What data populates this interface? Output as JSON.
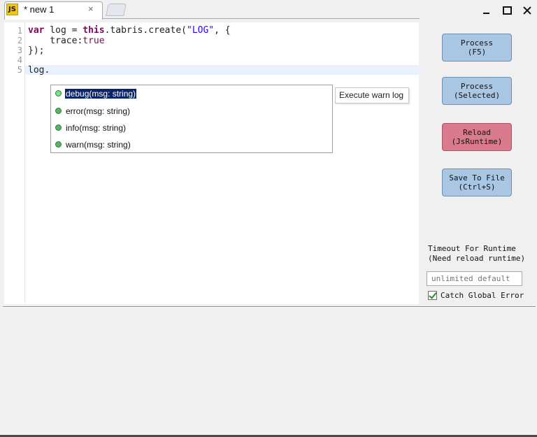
{
  "tab": {
    "icon_text": "JS",
    "title": "* new 1",
    "close": "×"
  },
  "window": {
    "minimize": "minimize",
    "maximize": "maximize",
    "close": "close"
  },
  "editor": {
    "line_numbers": [
      "1",
      "2",
      "3",
      "4",
      "5"
    ],
    "lines": {
      "l1_kw1": "var",
      "l1_mid": " log = ",
      "l1_kw2": "this",
      "l1_call": ".tabris.create(",
      "l1_str": "\"LOG\"",
      "l1_end": ", {",
      "l2_key": "    trace:",
      "l2_val": "true",
      "l3": "});",
      "l5": "log."
    }
  },
  "autocomplete": {
    "items": [
      {
        "label": "debug(msg: string)",
        "selected": true
      },
      {
        "label": "error(msg: string)",
        "selected": false
      },
      {
        "label": "info(msg: string)",
        "selected": false
      },
      {
        "label": "warn(msg: string)",
        "selected": false
      }
    ],
    "tooltip": "Execute warn log"
  },
  "panel": {
    "process": {
      "line1": "Process",
      "line2": "(F5)"
    },
    "process_selected": {
      "line1": "Process",
      "line2": "(Selected)"
    },
    "reload": {
      "line1": "Reload",
      "line2": "(JsRuntime)"
    },
    "save": {
      "line1": "Save To File",
      "line2": "(Ctrl+S)"
    },
    "timeout_label": {
      "line1": "Timeout For Runtime",
      "line2": "(Need reload runtime)"
    },
    "timeout_placeholder": "unlimited default",
    "catch_label": "Catch Global Error",
    "catch_checked": true
  },
  "colors": {
    "process": "#a9c6e3",
    "reload": "#da7b8d",
    "selection": "#0a246a"
  }
}
